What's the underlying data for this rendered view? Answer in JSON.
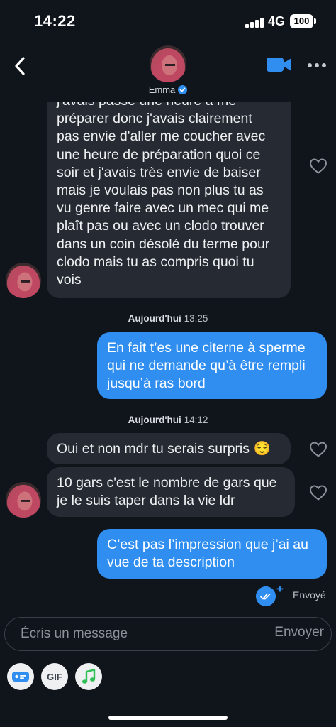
{
  "status_bar": {
    "time": "14:22",
    "network": "4G",
    "battery": "100"
  },
  "header": {
    "contact_name": "Emma",
    "verified": true
  },
  "messages": {
    "m1_lines": [
      "j'avais passé une heure à me",
      "préparer donc j'avais clairement",
      "pas envie d'aller me coucher avec",
      "une heure de préparation quoi ce",
      "soir et j'avais très envie de baiser",
      "mais je voulais pas non plus tu as",
      "vu genre faire avec un mec qui me",
      "plaît pas ou avec un clodo trouver",
      "dans un coin désolé du terme pour",
      "clodo mais tu as compris quoi tu",
      "vois"
    ],
    "ts1_day": "Aujourd'hui",
    "ts1_time": "13:25",
    "m2_lines": [
      "En fait t’es une citerne à sperme",
      "qui ne demande qu’à être rempli",
      "jusqu’à ras bord"
    ],
    "ts2_day": "Aujourd'hui",
    "ts2_time": "14:12",
    "m3_text": "Oui et non mdr tu serais surpris",
    "m3_emoji": "😌",
    "m4_lines": [
      "10 gars c'est le nombre de gars que",
      "je le suis taper dans la vie ldr"
    ],
    "m5_lines": [
      "C’est pas l’impression que j’ai au",
      "vue de ta description"
    ],
    "sent_status": "Envoyé"
  },
  "composer": {
    "placeholder": "Écris un message",
    "send_label": "Envoyer"
  },
  "toolbar": {
    "gif_label": "GIF"
  },
  "colors": {
    "background": "#10141b",
    "incoming_bubble": "#262b33",
    "outgoing_bubble": "#2f8ef0",
    "accent": "#2f8ef0"
  }
}
